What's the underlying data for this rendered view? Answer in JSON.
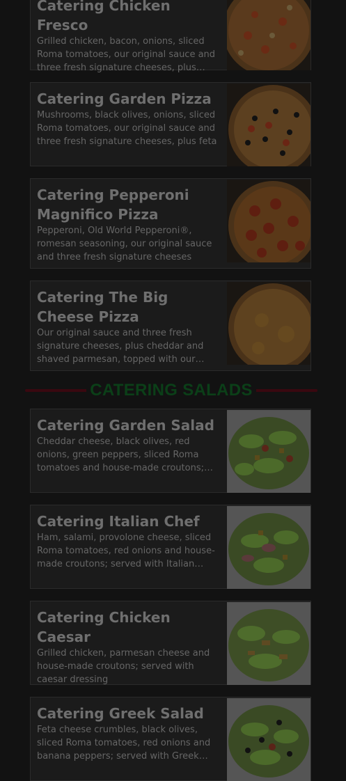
{
  "colors": {
    "background": "#121212",
    "card_bg": "#1b1b1b",
    "title": "#6f6f6f",
    "desc": "#666666",
    "section_title": "#0b3f18",
    "section_rule": "#3a0810"
  },
  "pizzas": [
    {
      "title": "Catering Chicken Fresco",
      "description": "Grilled chicken, bacon, onions, sliced Roma tomatoes, our original sauce and three fresh signature cheeses, plus…",
      "image_icon": "chicken-fresco-pizza-image"
    },
    {
      "title": "Catering Garden Pizza",
      "description": "Mushrooms, black olives, onions, sliced Roma tomatoes, our original sauce and three fresh signature cheeses, plus feta",
      "image_icon": "garden-pizza-image"
    },
    {
      "title": "Catering Pepperoni Magnifico Pizza",
      "description": "Pepperoni, Old World Pepperoni®, romesan seasoning, our original sauce and three fresh signature cheeses",
      "image_icon": "pepperoni-pizza-image"
    },
    {
      "title": "Catering The Big Cheese Pizza",
      "description": "Our original sauce and three fresh signature cheeses, plus cheddar and shaved parmesan, topped with our…",
      "image_icon": "cheese-pizza-image"
    }
  ],
  "section": {
    "title": "CATERING SALADS"
  },
  "salads": [
    {
      "title": "Catering Garden Salad",
      "description": "Cheddar cheese, black olives, red onions, green peppers, sliced Roma tomatoes and house-made croutons; served with…",
      "image_icon": "garden-salad-image"
    },
    {
      "title": "Catering Italian Chef",
      "description": "Ham, salami, provolone cheese, sliced Roma tomatoes, red onions and house-made croutons; served with Italian…",
      "image_icon": "italian-chef-salad-image"
    },
    {
      "title": "Catering Chicken Caesar",
      "description": "Grilled chicken, parmesan cheese and house-made croutons; served with caesar dressing",
      "image_icon": "chicken-caesar-salad-image"
    },
    {
      "title": "Catering Greek Salad",
      "description": "Feta cheese crumbles, black olives, sliced Roma tomatoes, red onions and banana peppers; served with Greek…",
      "image_icon": "greek-salad-image"
    }
  ]
}
